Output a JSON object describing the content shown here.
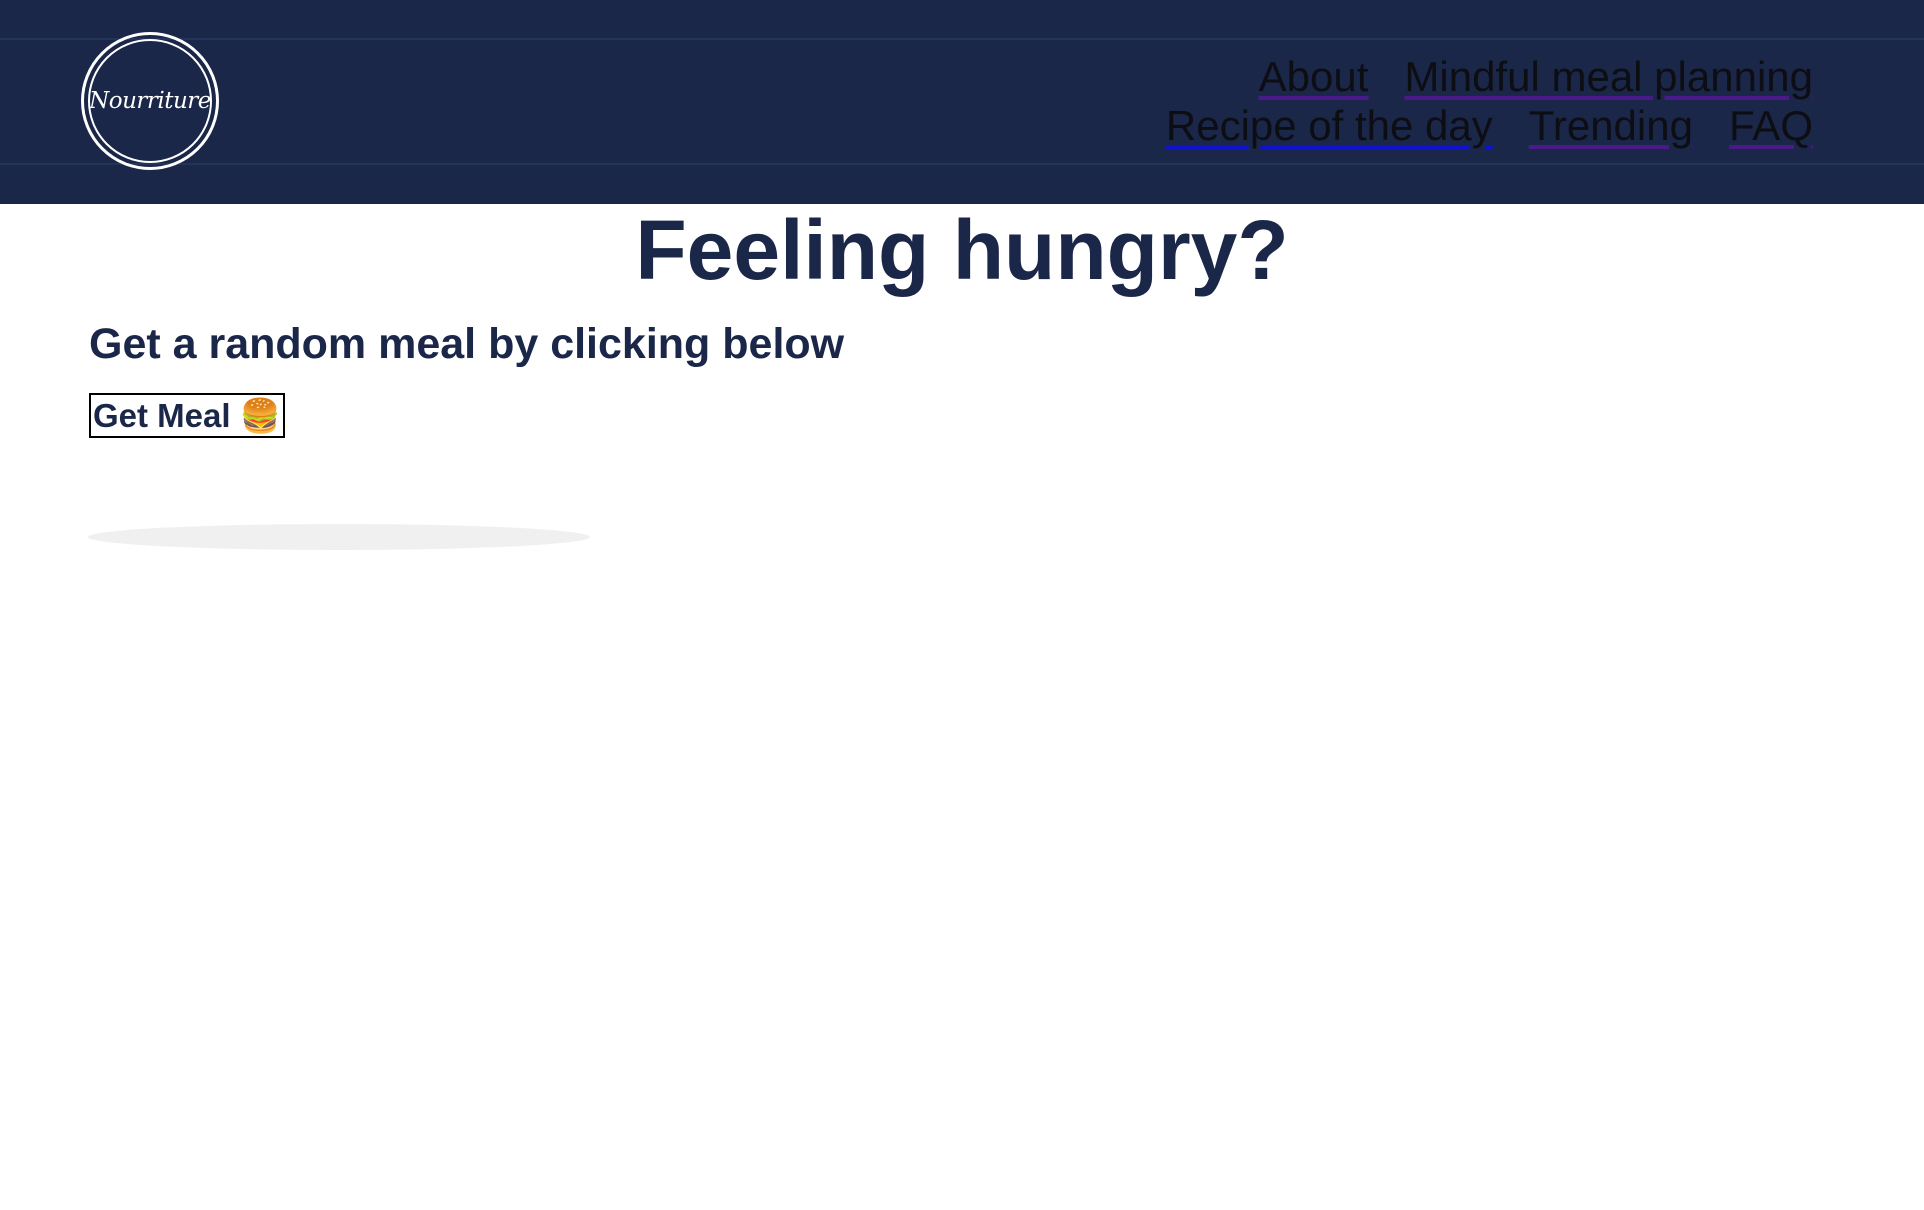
{
  "brand": {
    "logo_text": "Nourriture"
  },
  "nav": {
    "row1": [
      {
        "label": "About"
      },
      {
        "label": "Mindful meal planning"
      }
    ],
    "row2": [
      {
        "label": "Recipe of the day"
      },
      {
        "label": "Trending"
      },
      {
        "label": "FAQ"
      }
    ]
  },
  "main": {
    "title": "Feeling hungry?",
    "subtitle": "Get a random meal by clicking below",
    "button_label": "Get Meal 🍔"
  },
  "colors": {
    "header_bg": "#1b2749",
    "heading_text": "#1b2749",
    "visited_link_underline": "#4b1a8a",
    "unvisited_link_underline": "#1010d0"
  }
}
